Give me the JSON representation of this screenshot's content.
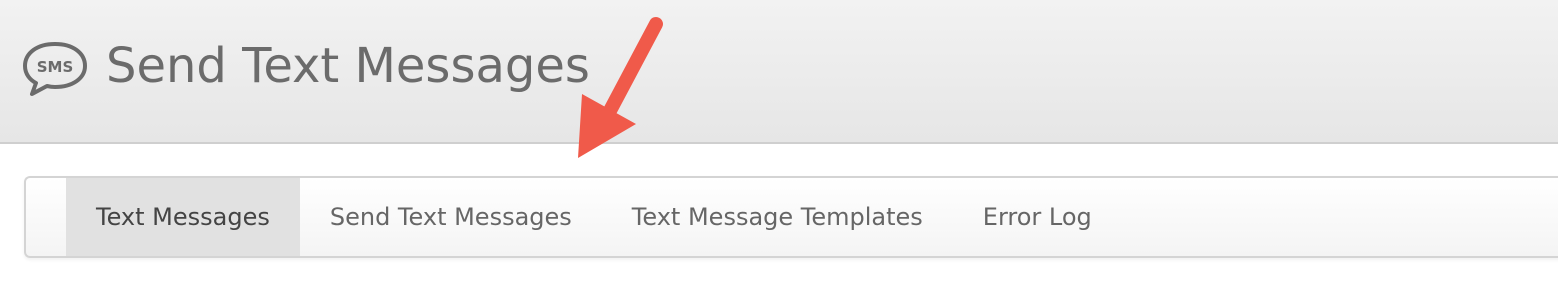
{
  "header": {
    "icon_text": "SMS",
    "title": "Send Text Messages"
  },
  "tabs": [
    {
      "label": "Text Messages",
      "active": true
    },
    {
      "label": "Send Text Messages",
      "active": false
    },
    {
      "label": "Text Message Templates",
      "active": false
    },
    {
      "label": "Error Log",
      "active": false
    }
  ],
  "annotation": {
    "arrow_color": "#f05a4a",
    "arrow_icon": "pointer-arrow-icon"
  },
  "colors": {
    "header_bg": "#e9e9e9",
    "active_tab_bg": "#e1e1e1",
    "title_text": "#6b6b6b"
  }
}
